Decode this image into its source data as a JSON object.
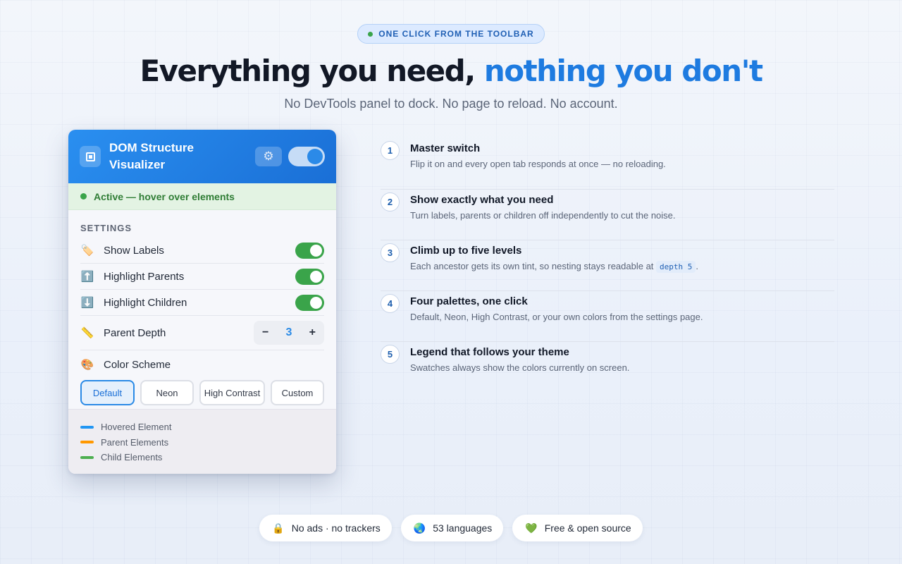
{
  "hero": {
    "pill": "ONE CLICK FROM THE TOOLBAR",
    "title_main": "Everything you need, ",
    "title_accent": "nothing you don't",
    "subtitle": "No DevTools panel to dock. No page to reload. No account."
  },
  "popup": {
    "title": "DOM Structure Visualizer",
    "settings_icon": "gear-icon",
    "master_enabled": true,
    "status": "Active — hover over elements",
    "section_label": "SETTINGS",
    "toggles": [
      {
        "icon": "🏷️",
        "icon_name": "label-tag-icon",
        "label": "Show Labels",
        "on": true
      },
      {
        "icon": "⬆️",
        "icon_name": "arrow-up-icon",
        "label": "Highlight Parents",
        "on": true
      },
      {
        "icon": "⬇️",
        "icon_name": "arrow-down-icon",
        "label": "Highlight Children",
        "on": true
      }
    ],
    "depth": {
      "icon": "📏",
      "icon_name": "ruler-icon",
      "label": "Parent Depth",
      "minus": "−",
      "value": "3",
      "plus": "+"
    },
    "color": {
      "icon": "🎨",
      "icon_name": "palette-icon",
      "label": "Color Scheme"
    },
    "schemes": [
      "Default",
      "Neon",
      "High Contrast",
      "Custom"
    ],
    "active_scheme": "Default",
    "legend": [
      {
        "label": "Hovered Element",
        "color": "#2196f3"
      },
      {
        "label": "Parent Elements",
        "color": "#ff9800"
      },
      {
        "label": "Child Elements",
        "color": "#4caf50"
      }
    ]
  },
  "steps": [
    {
      "num": "1",
      "title": "Master switch",
      "desc": "Flip it on and every open tab responds at once — no reloading."
    },
    {
      "num": "2",
      "title": "Show exactly what you need",
      "desc": "Turn labels, parents or children off independently to cut the noise."
    },
    {
      "num": "3",
      "title": "Climb up to five levels",
      "desc_pre": "Each ancestor gets its own tint, so nesting stays readable at ",
      "code": "depth 5",
      "desc_post": "."
    },
    {
      "num": "4",
      "title": "Four palettes, one click",
      "desc": "Default, Neon, High Contrast, or your own colors from the settings page."
    },
    {
      "num": "5",
      "title": "Legend that follows your theme",
      "desc": "Swatches always show the colors currently on screen."
    }
  ],
  "badges": [
    {
      "icon": "🔒",
      "icon_name": "lock-icon",
      "label": "No ads · no trackers"
    },
    {
      "icon": "🌏",
      "icon_name": "globe-icon",
      "label": "53 languages"
    },
    {
      "icon": "💚",
      "icon_name": "heart-icon",
      "label": "Free & open source"
    }
  ]
}
